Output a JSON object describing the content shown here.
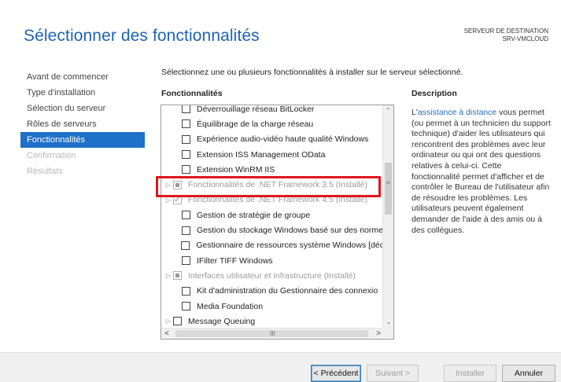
{
  "header": {
    "title": "Sélectionner des fonctionnalités",
    "destination_label": "SERVEUR DE DESTINATION",
    "destination_server": "SRV-VMCLOUD"
  },
  "nav": {
    "items": [
      {
        "label": "Avant de commencer",
        "state": "normal"
      },
      {
        "label": "Type d'installation",
        "state": "normal"
      },
      {
        "label": "Sélection du serveur",
        "state": "normal"
      },
      {
        "label": "Rôles de serveurs",
        "state": "normal"
      },
      {
        "label": "Fonctionnalités",
        "state": "active"
      },
      {
        "label": "Confirmation",
        "state": "disabled"
      },
      {
        "label": "Résultats",
        "state": "disabled"
      }
    ]
  },
  "main": {
    "instruction": "Sélectionnez une ou plusieurs fonctionnalités à installer sur le serveur sélectionné.",
    "features_heading": "Fonctionnalités",
    "description_heading": "Description",
    "features": [
      {
        "label": "Déverrouillage réseau BitLocker",
        "checkbox": "unchecked",
        "expandable": false,
        "installed": false
      },
      {
        "label": "Équilibrage de la charge réseau",
        "checkbox": "unchecked",
        "expandable": false,
        "installed": false
      },
      {
        "label": "Expérience audio-vidéo haute qualité Windows",
        "checkbox": "unchecked",
        "expandable": false,
        "installed": false
      },
      {
        "label": "Extension ISS Management OData",
        "checkbox": "unchecked",
        "expandable": false,
        "installed": false
      },
      {
        "label": "Extension WinRM IIS",
        "checkbox": "unchecked",
        "expandable": false,
        "installed": false
      },
      {
        "label": "Fonctionnalités de .NET Framework 3.5 (Installé)",
        "checkbox": "partial",
        "expandable": true,
        "installed": true
      },
      {
        "label": "Fonctionnalités de .NET Framework 4.5 (Installé)",
        "checkbox": "checked",
        "expandable": true,
        "installed": true
      },
      {
        "label": "Gestion de stratégie de groupe",
        "checkbox": "unchecked",
        "expandable": false,
        "installed": false
      },
      {
        "label": "Gestion du stockage Windows basé sur des norme",
        "checkbox": "unchecked",
        "expandable": false,
        "installed": false
      },
      {
        "label": "Gestionnaire de ressources système Windows [déc",
        "checkbox": "unchecked",
        "expandable": false,
        "installed": false
      },
      {
        "label": "IFilter TIFF Windows",
        "checkbox": "unchecked",
        "expandable": false,
        "installed": false
      },
      {
        "label": "Interfaces utilisateur et infrastructure (Installé)",
        "checkbox": "partial",
        "expandable": true,
        "installed": true
      },
      {
        "label": "Kit d'administration du Gestionnaire des connexio",
        "checkbox": "unchecked",
        "expandable": false,
        "installed": false
      },
      {
        "label": "Media Foundation",
        "checkbox": "unchecked",
        "expandable": false,
        "installed": false
      },
      {
        "label": "Message Queuing",
        "checkbox": "unchecked",
        "expandable": true,
        "installed": false
      }
    ],
    "description": {
      "prefix": "L'",
      "link": "assistance à distance",
      "body": " vous permet (ou permet à un technicien du support technique) d'aider les utilisateurs qui rencontrent des problèmes avec leur ordinateur ou qui ont des questions relatives à celui-ci. Cette fonctionnalité permet d'afficher et de contrôler le Bureau de l'utilisateur afin de résoudre les problèmes. Les utilisateurs peuvent également demander de l'aide à des amis ou à des collègues."
    }
  },
  "scrollbar": {
    "up": "⌃",
    "down": "⌄",
    "left": "<",
    "right": ">",
    "grip_v": "≡",
    "grip_h": "III"
  },
  "footer": {
    "previous": "< Précédent",
    "next": "Suivant >",
    "install": "Installer",
    "cancel": "Annuler"
  },
  "colors": {
    "accent": "#1e70c8",
    "highlight_border": "#e0161b",
    "link": "#1f6fc0"
  }
}
